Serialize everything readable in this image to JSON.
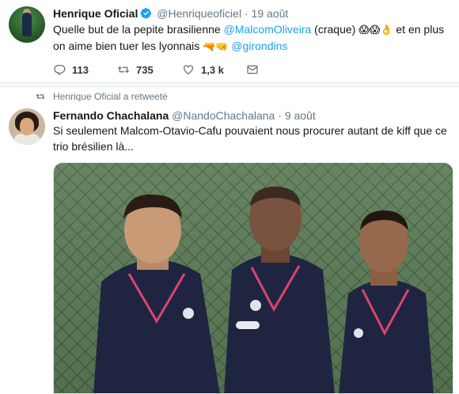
{
  "tweet1": {
    "author_name": "Henrique Oficial",
    "author_handle": "@Henriqueoficiel",
    "separator": "·",
    "date": "19 août",
    "verified": true,
    "text_parts": {
      "p1": "Quelle but de la pepite brasilienne ",
      "mention1": "@MalcomOliveira",
      "p2": " (craque) ",
      "emojis1": "😱😱👌",
      "p3": " et en plus on aime bien tuer les lyonnais ",
      "emojis2": "🔫🤜",
      "mention2": "@girondins"
    },
    "actions": {
      "replies": "113",
      "retweets": "735",
      "likes": "1,3 k"
    }
  },
  "retweet_context": "Henrique Oficial a retweeté",
  "tweet2": {
    "author_name": "Fernando Chachalana",
    "author_handle": "@NandoChachalana",
    "separator": "·",
    "date": "9 août",
    "text": "Si seulement Malcom-Otavio-Cafu pouvaient nous procurer autant de kiff que ce trio brésilien là..."
  },
  "icons": {
    "verified": "verified-badge-icon",
    "reply": "reply-icon",
    "retweet": "retweet-icon",
    "like": "heart-icon",
    "dm": "envelope-icon",
    "retweet_context": "retweet-small-icon"
  },
  "colors": {
    "link": "#1da1f2",
    "secondary": "#657786",
    "text": "#14171a",
    "jersey": "#1f2540",
    "accent_pink": "#d9456e"
  }
}
